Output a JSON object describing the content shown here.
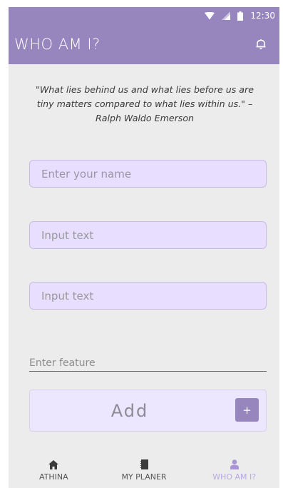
{
  "status_bar": {
    "time": "12:30",
    "wifi_icon": "wifi-icon",
    "signal_icon": "signal-icon",
    "battery_icon": "battery-icon"
  },
  "app_bar": {
    "title": "WHO AM I?",
    "action_icon": "bell-icon"
  },
  "quote": {
    "text": "\"What lies behind us and what lies before us are tiny matters compared to what lies within us.\" – Ralph Waldo Emerson"
  },
  "form": {
    "name_placeholder": "Enter your name",
    "input1_placeholder": "Input text",
    "input2_placeholder": "Input text",
    "feature_placeholder": "Enter feature"
  },
  "add_panel": {
    "label": "Add",
    "plus_label": "+"
  },
  "bottom_nav": {
    "items": [
      {
        "label": "ATHINA",
        "icon": "home-icon"
      },
      {
        "label": "MY PLANER",
        "icon": "notebook-icon"
      },
      {
        "label": "WHO AM I?",
        "icon": "person-icon"
      }
    ]
  },
  "colors": {
    "primary": "#9785bd",
    "input_bg": "#e8deff",
    "add_bg": "#ede6ff",
    "nav_active": "#b9a8df",
    "background": "#ececec"
  }
}
